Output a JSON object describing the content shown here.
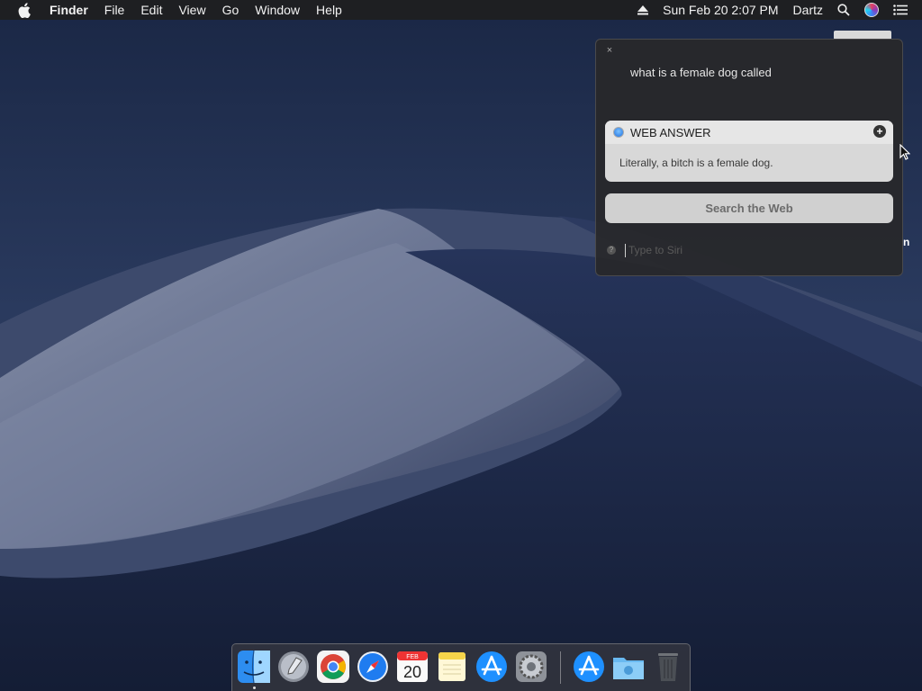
{
  "menubar": {
    "app_name": "Finder",
    "menus": [
      "File",
      "Edit",
      "View",
      "Go",
      "Window",
      "Help"
    ],
    "datetime": "Sun Feb 20  2:07 PM",
    "user": "Dartz"
  },
  "desktop": {
    "partial_label": "n"
  },
  "siri": {
    "close_glyph": "×",
    "query": "what is a female dog called",
    "answer_header": "WEB ANSWER",
    "answer_text": "Literally, a bitch is a female dog.",
    "search_button": "Search the Web",
    "input_placeholder": "Type to Siri",
    "input_value": ""
  },
  "dock": {
    "apps": [
      "Finder",
      "Launchpad",
      "Google Chrome",
      "Safari",
      "Calendar",
      "Notes",
      "App Store",
      "System Preferences",
      "App Store",
      "Downloads",
      "Trash"
    ],
    "calendar_month": "FEB",
    "calendar_day": "20"
  }
}
